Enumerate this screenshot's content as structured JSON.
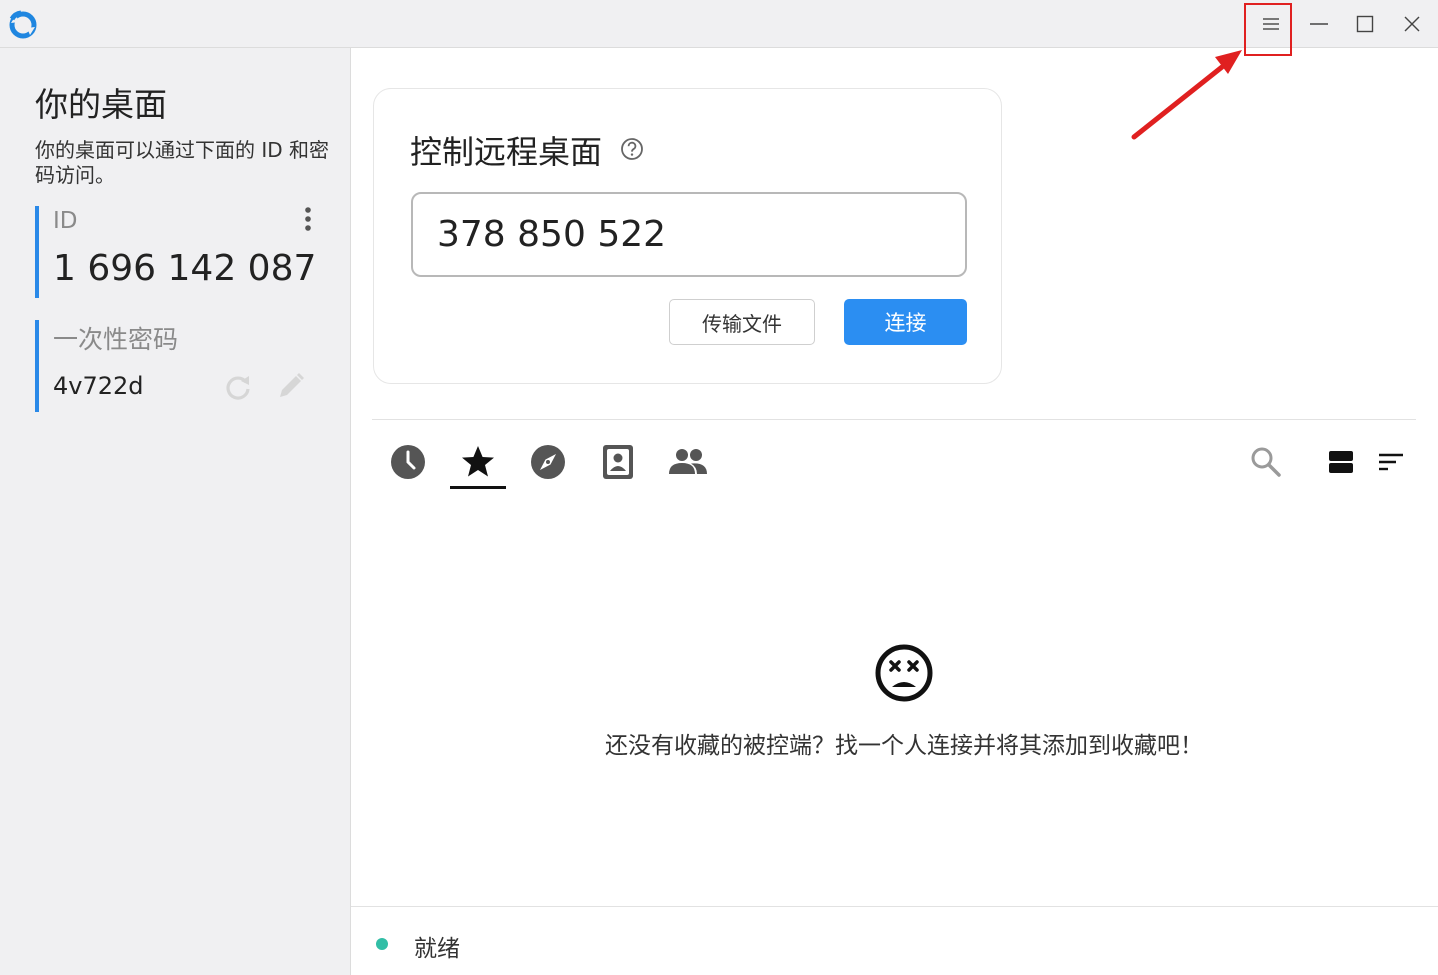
{
  "colors": {
    "accent": "#2b8ef2",
    "id_bar": "#2a89e8",
    "status_ready": "#32bea6",
    "annotation": "#e02020"
  },
  "titlebar": {
    "icons": [
      "rustdesk-logo-icon",
      "hamburger-menu-icon",
      "minimize-icon",
      "maximize-icon",
      "close-icon"
    ]
  },
  "sidebar": {
    "title": "你的桌面",
    "description": "你的桌面可以通过下面的 ID 和密码访问。",
    "id_label": "ID",
    "id_value": "1 696 142 087",
    "password_label": "一次性密码",
    "password_value": "4v722d"
  },
  "control": {
    "title": "控制远程桌面",
    "remote_id_value": "378 850 522",
    "transfer_label": "传输文件",
    "connect_label": "连接"
  },
  "tabs": {
    "icons": [
      "clock-icon",
      "star-icon",
      "compass-icon",
      "address-book-icon",
      "group-icon"
    ],
    "active": "star-icon"
  },
  "peers": {
    "empty_message": "还没有收藏的被控端？找一个人连接并将其添加到收藏吧！"
  },
  "status": {
    "text": "就绪"
  }
}
